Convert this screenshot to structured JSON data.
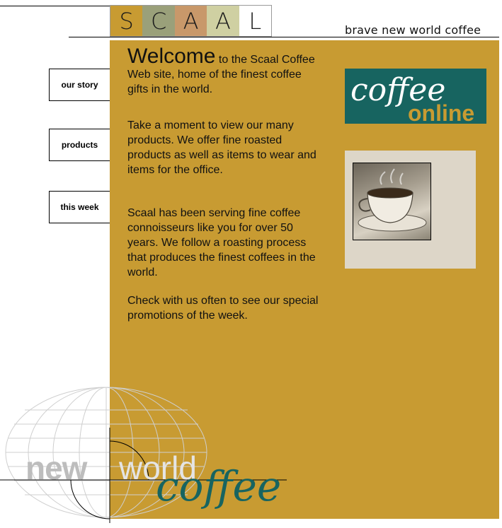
{
  "header": {
    "logo_letters": [
      "S",
      "C",
      "A",
      "A",
      "L"
    ],
    "logo_colors": [
      "#c89b32",
      "#9aa07a",
      "#c8986a",
      "#cfd0a2",
      "#ffffff"
    ],
    "tagline": "brave new world coffee"
  },
  "nav": {
    "items": [
      {
        "label": "our story"
      },
      {
        "label": "products"
      },
      {
        "label": "this week"
      }
    ]
  },
  "main": {
    "welcome_big": "Welcome",
    "welcome_rest": " to the Scaal Coffee Web site, home of the finest coffee gifts in the world.",
    "para2": "Take a moment to view our many products. We offer fine roasted products as well as items to wear and items for the office.",
    "para3": "Scaal has been serving fine coffee connoisseurs like you for over 50 years. We follow a roasting process that produces the finest coffees in the world.",
    "para4": "Check with us often to see our special promotions of the week."
  },
  "promo": {
    "coffee": "coffee",
    "online": "online",
    "box_color": "#176460"
  },
  "footer_logo": {
    "new": "new",
    "world": "world",
    "coffee": "coffee"
  },
  "colors": {
    "gold": "#c89b32",
    "teal": "#176460"
  }
}
